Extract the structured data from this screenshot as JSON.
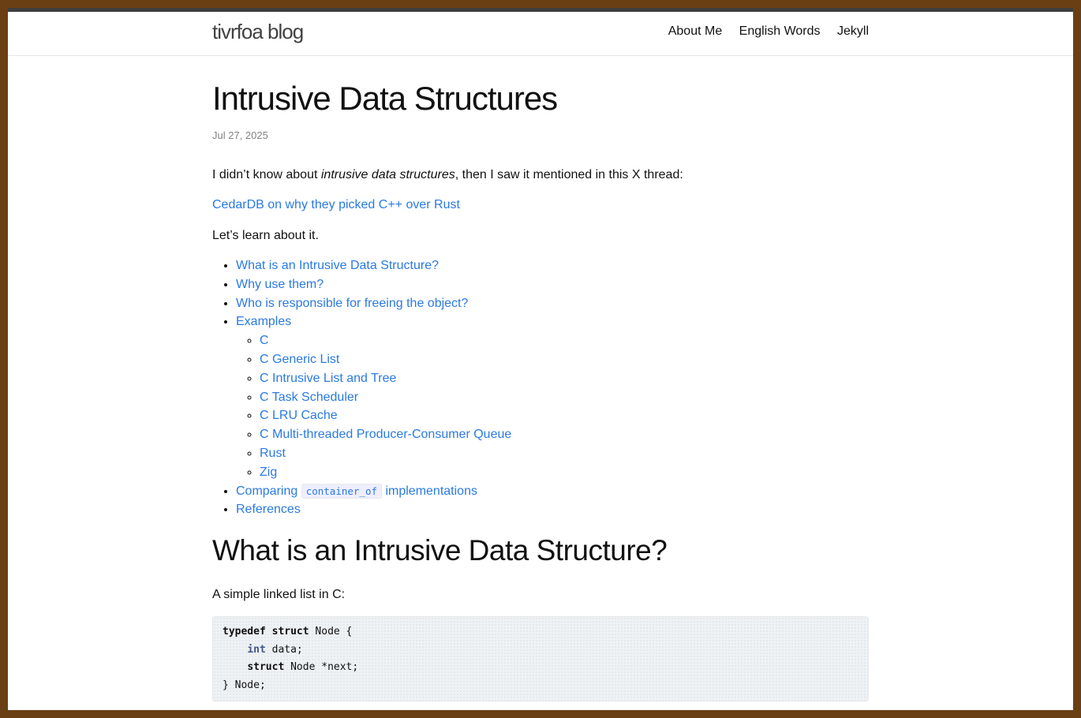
{
  "header": {
    "site_title": "tivrfoa blog",
    "nav": [
      "About Me",
      "English Words",
      "Jekyll"
    ]
  },
  "post": {
    "title": "Intrusive Data Structures",
    "date": "Jul 27, 2025",
    "intro_before": "I didn’t know about ",
    "intro_em": "intrusive data structures",
    "intro_after": ", then I saw it mentioned in this X thread:",
    "thread_link": "CedarDB on why they picked C++ over Rust",
    "lets_learn": "Let’s learn about it.",
    "toc": {
      "item1": "What is an Intrusive Data Structure?",
      "item2": "Why use them?",
      "item3": "Who is responsible for freeing the object?",
      "item4": "Examples",
      "examples": [
        "C",
        "C Generic List",
        "C Intrusive List and Tree",
        "C Task Scheduler",
        "C LRU Cache",
        "C Multi-threaded Producer-Consumer Queue",
        "Rust",
        "Zig"
      ],
      "item5_before": "Comparing ",
      "item5_code": "container_of",
      "item5_after": " implementations",
      "item6": "References"
    },
    "section_heading": "What is an Intrusive Data Structure?",
    "section_para": "A simple linked list in C:",
    "code": {
      "l1_kw1": "typedef",
      "l1_kw2": "struct",
      "l1_rest": " Node {",
      "l2_ty": "int",
      "l2_rest": " data;",
      "l3_kw": "struct",
      "l3_rest": " Node *next;",
      "l4": "} Node;"
    }
  }
}
